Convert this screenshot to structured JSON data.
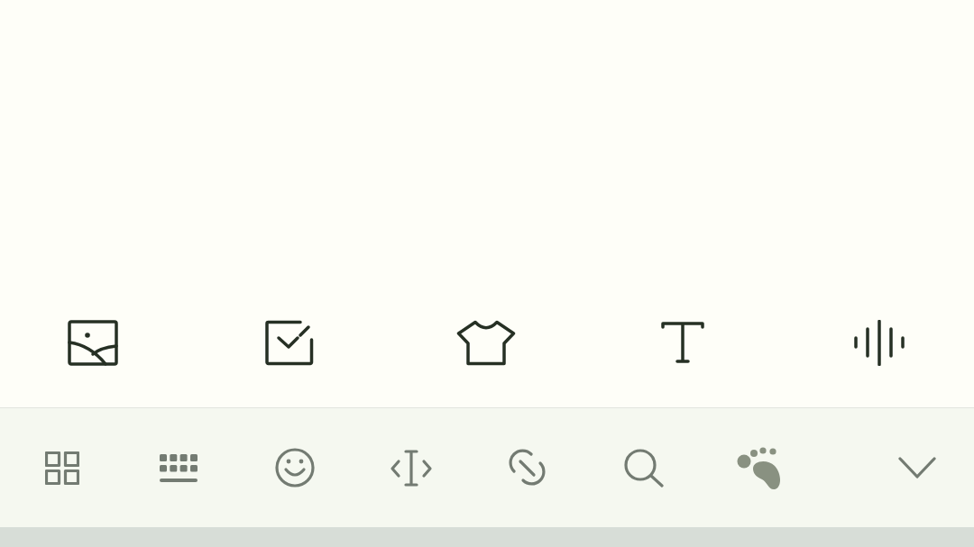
{
  "insert_bar": {
    "items": [
      {
        "kind": "image"
      },
      {
        "kind": "checklist"
      },
      {
        "kind": "clothing"
      },
      {
        "kind": "text"
      },
      {
        "kind": "voice"
      }
    ]
  },
  "toolbar": {
    "items": [
      {
        "kind": "apps"
      },
      {
        "kind": "keyboard"
      },
      {
        "kind": "emoji"
      },
      {
        "kind": "cursor"
      },
      {
        "kind": "link"
      },
      {
        "kind": "search"
      },
      {
        "kind": "footprint"
      },
      {
        "kind": "collapse"
      }
    ]
  }
}
